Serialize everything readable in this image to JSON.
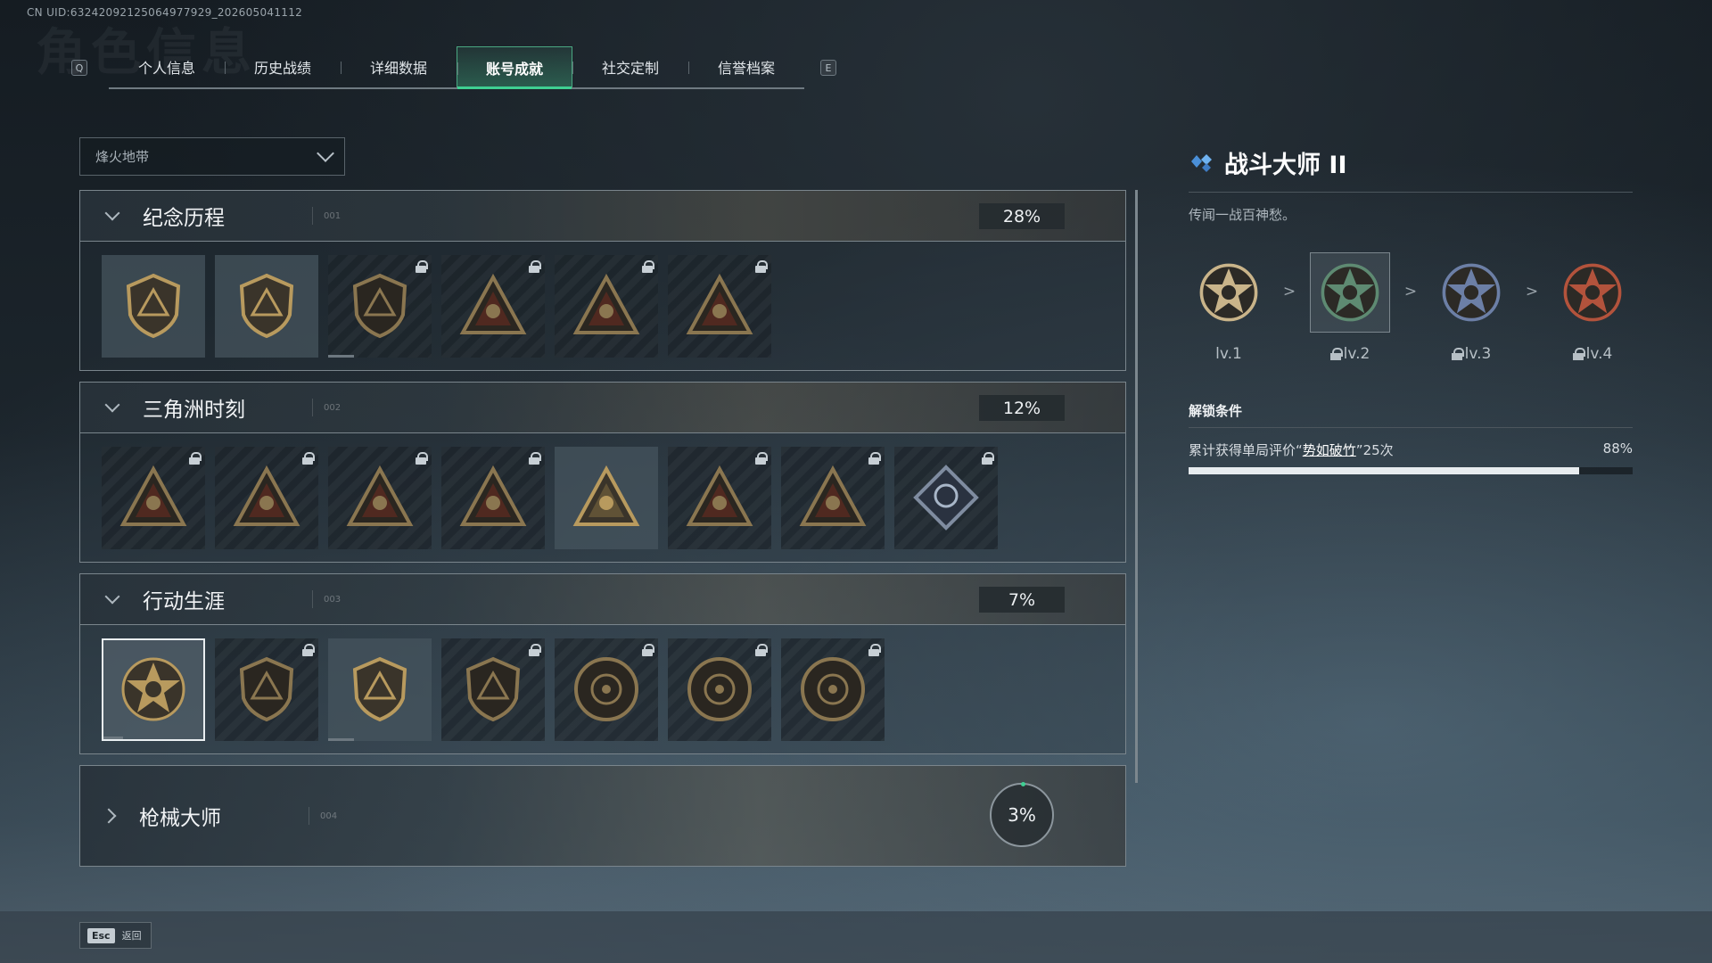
{
  "uid": "CN UID:63242092125064977929_202605041112",
  "page_title_watermark": "角色信息",
  "tabbar": {
    "left_key": "Q",
    "right_key": "E",
    "tabs": [
      {
        "label": "个人信息",
        "active": false
      },
      {
        "label": "历史战绩",
        "active": false
      },
      {
        "label": "详细数据",
        "active": false
      },
      {
        "label": "账号成就",
        "active": true
      },
      {
        "label": "社交定制",
        "active": false
      },
      {
        "label": "信誉档案",
        "active": false
      }
    ]
  },
  "filter": {
    "value": "烽火地带"
  },
  "sections": [
    {
      "title": "纪念历程",
      "index": "001",
      "percent": "28%",
      "collapsed": false,
      "badges": [
        {
          "icon": "triangle-a-emblem-icon",
          "locked": false,
          "shape": "shield",
          "selected": false
        },
        {
          "icon": "helicopter-emblem-icon",
          "locked": false,
          "shape": "shield",
          "selected": false
        },
        {
          "icon": "diamond-emblem-icon",
          "locked": true,
          "shape": "shield",
          "selected": false,
          "progress": 0.25
        },
        {
          "icon": "tower-emblem-icon",
          "locked": true,
          "shape": "triangle",
          "selected": false
        },
        {
          "icon": "hooded-figure-emblem-icon",
          "locked": true,
          "shape": "triangle",
          "selected": false
        },
        {
          "icon": "skull-crossed-emblem-icon",
          "locked": true,
          "shape": "triangle",
          "selected": false
        }
      ]
    },
    {
      "title": "三角洲时刻",
      "index": "002",
      "percent": "12%",
      "collapsed": false,
      "badges": [
        {
          "icon": "bottle-emblem-icon",
          "locked": true,
          "shape": "triangle",
          "selected": false
        },
        {
          "icon": "armor-emblem-icon",
          "locked": true,
          "shape": "triangle",
          "selected": false
        },
        {
          "icon": "kneeling-soldier-emblem-icon",
          "locked": true,
          "shape": "triangle",
          "selected": false
        },
        {
          "icon": "hexagon-emblem-icon",
          "locked": true,
          "shape": "triangle",
          "selected": false
        },
        {
          "icon": "squad-emblem-icon",
          "locked": false,
          "shape": "triangle",
          "selected": false
        },
        {
          "icon": "beast-emblem-icon",
          "locked": true,
          "shape": "triangle",
          "selected": false
        },
        {
          "icon": "fish-emblem-icon",
          "locked": true,
          "shape": "triangle",
          "selected": false
        },
        {
          "icon": "rose-diamond-emblem-icon",
          "locked": true,
          "shape": "diamond",
          "selected": false
        }
      ]
    },
    {
      "title": "行动生涯",
      "index": "003",
      "percent": "7%",
      "collapsed": false,
      "badges": [
        {
          "icon": "star-skull-emblem-icon",
          "locked": false,
          "shape": "star",
          "selected": true,
          "progress": 0.2
        },
        {
          "icon": "chevron-shield-emblem-icon",
          "locked": true,
          "shape": "shield",
          "selected": false
        },
        {
          "icon": "target-shield-emblem-icon",
          "locked": false,
          "shape": "shield",
          "selected": false,
          "progress": 0.25
        },
        {
          "icon": "d20-emblem-icon",
          "locked": true,
          "shape": "shield",
          "selected": false
        },
        {
          "icon": "ring-emblem-icon",
          "locked": true,
          "shape": "circle",
          "selected": false
        },
        {
          "icon": "crosshair-skull-emblem-icon",
          "locked": true,
          "shape": "circle",
          "selected": false
        },
        {
          "icon": "eye-emblem-icon",
          "locked": true,
          "shape": "circle",
          "selected": false
        }
      ]
    },
    {
      "title": "枪械大师",
      "index": "004",
      "percent": "3%",
      "collapsed": true,
      "badges": []
    }
  ],
  "detail": {
    "title": "战斗大师 II",
    "description": "传闻一战百神愁。",
    "levels": [
      {
        "label": "lv.1",
        "locked": false,
        "current": false,
        "color": "#c9b48a"
      },
      {
        "label": "lv.2",
        "locked": true,
        "current": true,
        "color": "#5e8a72"
      },
      {
        "label": "lv.3",
        "locked": true,
        "current": false,
        "color": "#6c7fa6"
      },
      {
        "label": "lv.4",
        "locked": true,
        "current": false,
        "color": "#b3533c"
      }
    ],
    "arrow": ">",
    "unlock_title": "解锁条件",
    "condition_prefix": "累计获得单局评价“",
    "condition_highlight": "势如破竹",
    "condition_suffix": "”25次",
    "progress_text": "88%",
    "progress": 0.88
  },
  "footer": {
    "esc_key": "Esc",
    "back_label": "返回"
  },
  "colors": {
    "accent_green": "#3fcf92",
    "gold": "#b89a5e",
    "diamond_blue": "#4a8fd8"
  }
}
